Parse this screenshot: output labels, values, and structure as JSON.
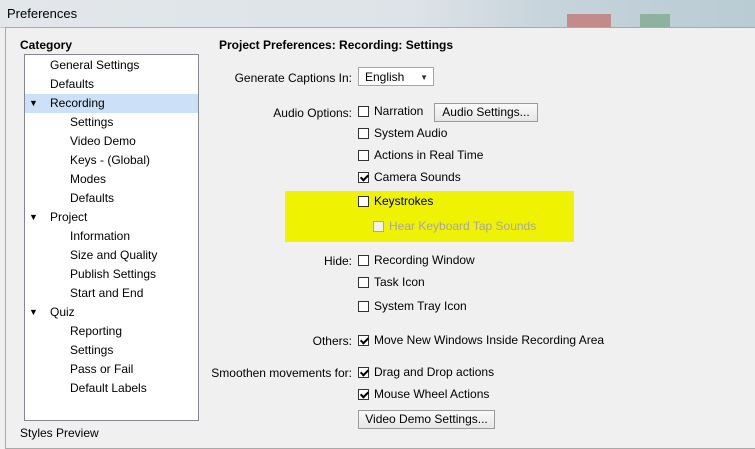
{
  "window": {
    "title": "Preferences"
  },
  "sidebar": {
    "heading": "Category",
    "items": [
      {
        "label": "General Settings",
        "level": 0,
        "arrow": ""
      },
      {
        "label": "Defaults",
        "level": 0,
        "arrow": ""
      },
      {
        "label": "Recording",
        "level": 0,
        "arrow": "▼",
        "selected": true
      },
      {
        "label": "Settings",
        "level": 1,
        "arrow": ""
      },
      {
        "label": "Video Demo",
        "level": 1,
        "arrow": ""
      },
      {
        "label": "Keys - (Global)",
        "level": 1,
        "arrow": ""
      },
      {
        "label": "Modes",
        "level": 1,
        "arrow": ""
      },
      {
        "label": "Defaults",
        "level": 1,
        "arrow": ""
      },
      {
        "label": "Project",
        "level": 0,
        "arrow": "▼"
      },
      {
        "label": "Information",
        "level": 1,
        "arrow": ""
      },
      {
        "label": "Size and Quality",
        "level": 1,
        "arrow": ""
      },
      {
        "label": "Publish Settings",
        "level": 1,
        "arrow": ""
      },
      {
        "label": "Start and End",
        "level": 1,
        "arrow": ""
      },
      {
        "label": "Quiz",
        "level": 0,
        "arrow": "▼"
      },
      {
        "label": "Reporting",
        "level": 1,
        "arrow": ""
      },
      {
        "label": "Settings",
        "level": 1,
        "arrow": ""
      },
      {
        "label": "Pass or Fail",
        "level": 1,
        "arrow": ""
      },
      {
        "label": "Default Labels",
        "level": 1,
        "arrow": ""
      }
    ],
    "footer": "Styles Preview"
  },
  "main": {
    "title": "Project Preferences: Recording: Settings",
    "captions": {
      "label": "Generate Captions In:",
      "value": "English"
    },
    "audio": {
      "label": "Audio Options:",
      "narration": {
        "label": "Narration",
        "checked": false
      },
      "audio_settings_button": "Audio Settings...",
      "system_audio": {
        "label": "System Audio",
        "checked": false
      },
      "actions_real_time": {
        "label": "Actions in Real Time",
        "checked": false
      },
      "camera_sounds": {
        "label": "Camera Sounds",
        "checked": true
      },
      "keystrokes": {
        "label": "Keystrokes",
        "checked": false
      },
      "keyboard_tap": {
        "label": "Hear Keyboard Tap Sounds",
        "checked": false,
        "disabled": true
      }
    },
    "hide": {
      "label": "Hide:",
      "recording_window": {
        "label": "Recording Window",
        "checked": false
      },
      "task_icon": {
        "label": "Task Icon",
        "checked": false
      },
      "system_tray_icon": {
        "label": "System Tray Icon",
        "checked": false
      }
    },
    "others": {
      "label": "Others:",
      "move_windows": {
        "label": "Move New Windows Inside Recording Area",
        "checked": true
      }
    },
    "smoothen": {
      "label": "Smoothen movements for:",
      "drag_drop": {
        "label": "Drag and Drop actions",
        "checked": true
      },
      "mouse_wheel": {
        "label": "Mouse Wheel Actions",
        "checked": true
      }
    },
    "video_demo_button": "Video Demo Settings..."
  },
  "colors": {
    "highlight": "#eff200",
    "selection": "#cce0f8"
  }
}
